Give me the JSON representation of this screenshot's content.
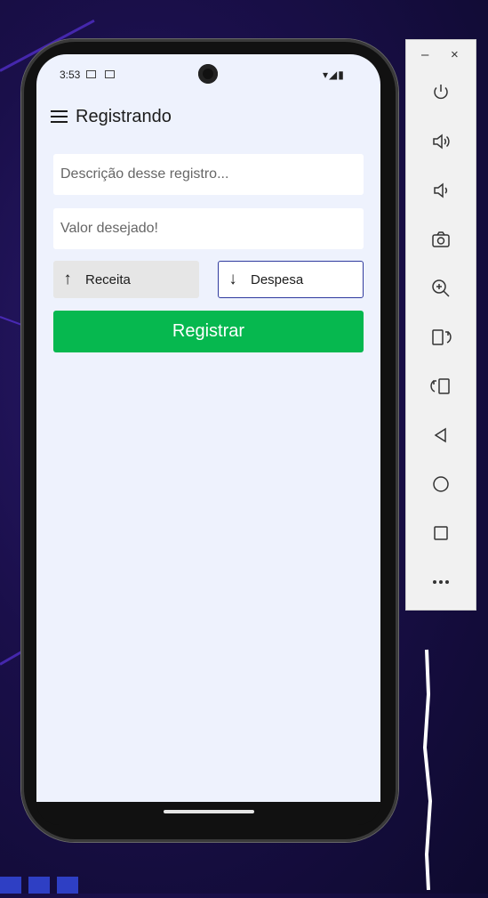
{
  "status_bar": {
    "time": "3:53"
  },
  "app_bar": {
    "title": "Registrando"
  },
  "form": {
    "description_placeholder": "Descrição desse registro...",
    "value_placeholder": "Valor desejado!",
    "income_label": "Receita",
    "expense_label": "Despesa",
    "submit_label": "Registrar"
  },
  "emulator_toolbar": {
    "minimize": "–",
    "close": "×",
    "buttons": [
      "power-icon",
      "volume-up-icon",
      "volume-down-icon",
      "camera-icon",
      "zoom-in-icon",
      "rotate-right-icon",
      "rotate-left-icon",
      "back-icon",
      "home-icon",
      "overview-icon",
      "more-icon"
    ]
  },
  "colors": {
    "accent_green": "#06b84f",
    "selected_border": "#2f3a9e",
    "screen_bg": "#eef2fd"
  }
}
